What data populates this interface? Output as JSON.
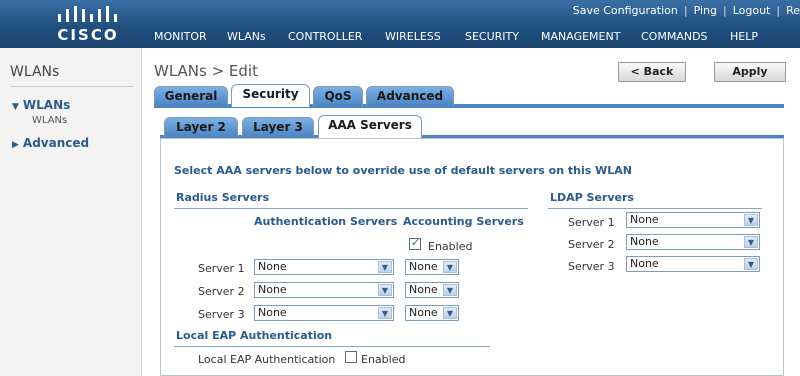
{
  "header": {
    "brand": "CISCO",
    "top_links": [
      "Save Configuration",
      "Ping",
      "Logout",
      "Re"
    ],
    "nav": [
      "MONITOR",
      "WLANs",
      "CONTROLLER",
      "WIRELESS",
      "SECURITY",
      "MANAGEMENT",
      "COMMANDS",
      "HELP"
    ]
  },
  "sidebar": {
    "title": "WLANs",
    "items": [
      {
        "label": "WLANs",
        "sub": "WLANs",
        "expanded": true
      },
      {
        "label": "Advanced",
        "expanded": false
      }
    ]
  },
  "page": {
    "title": "WLANs > Edit",
    "back_label": "< Back",
    "apply_label": "Apply"
  },
  "tabs": [
    "General",
    "Security",
    "QoS",
    "Advanced"
  ],
  "subtabs": [
    "Layer 2",
    "Layer 3",
    "AAA Servers"
  ],
  "aaa": {
    "notice": "Select AAA servers below to override use of default servers on this WLAN",
    "radius_title": "Radius Servers",
    "auth_col": "Authentication Servers",
    "acct_col": "Accounting Servers",
    "acct_enabled_label": "Enabled",
    "acct_enabled": true,
    "servers": [
      {
        "label": "Server 1",
        "auth": "None",
        "acct": "None"
      },
      {
        "label": "Server 2",
        "auth": "None",
        "acct": "None"
      },
      {
        "label": "Server 3",
        "auth": "None",
        "acct": "None"
      }
    ],
    "ldap_title": "LDAP Servers",
    "ldap": [
      {
        "label": "Server 1",
        "value": "None"
      },
      {
        "label": "Server 2",
        "value": "None"
      },
      {
        "label": "Server 3",
        "value": "None"
      }
    ],
    "local_eap_title": "Local EAP Authentication",
    "local_eap_label": "Local EAP Authentication",
    "local_eap_enabled_label": "Enabled",
    "local_eap_enabled": false
  },
  "icons": {
    "dropdown": "chevron-down-icon",
    "expanded": "triangle-down-icon",
    "collapsed": "triangle-right-icon",
    "checked": "checkmark-icon"
  },
  "colors": {
    "header": "#21507f",
    "tab": "#4d84c1",
    "section_text": "#2a5b8a"
  }
}
